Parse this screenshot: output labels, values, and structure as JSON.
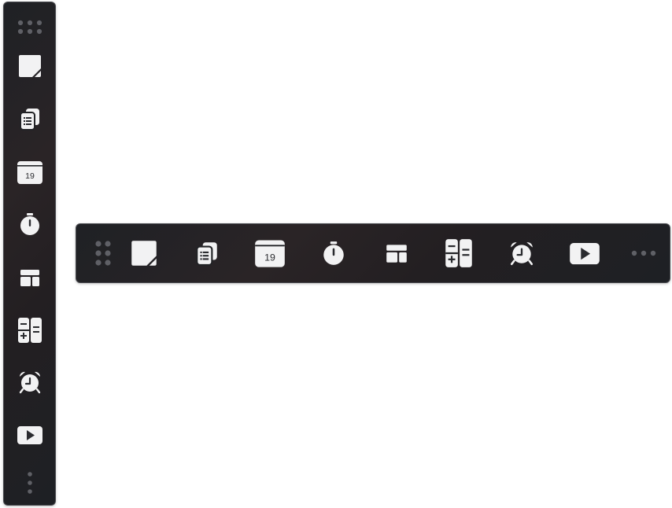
{
  "colors": {
    "toolbar_bg": "#222326",
    "toolbar_border": "#4a4b50",
    "icon_fill": "#f2f2f3",
    "grip_dots": "#5f6066",
    "icon_ink": "#2a2b2f"
  },
  "toolbar_items": [
    {
      "icon": "grip-icon"
    },
    {
      "icon": "sticky-note-icon"
    },
    {
      "icon": "documents-icon"
    },
    {
      "icon": "calendar-icon",
      "day": "19"
    },
    {
      "icon": "stopwatch-icon"
    },
    {
      "icon": "layout-icon"
    },
    {
      "icon": "calculator-icon"
    },
    {
      "icon": "alarm-clock-icon"
    },
    {
      "icon": "play-video-icon"
    },
    {
      "icon": "more-icon"
    }
  ]
}
